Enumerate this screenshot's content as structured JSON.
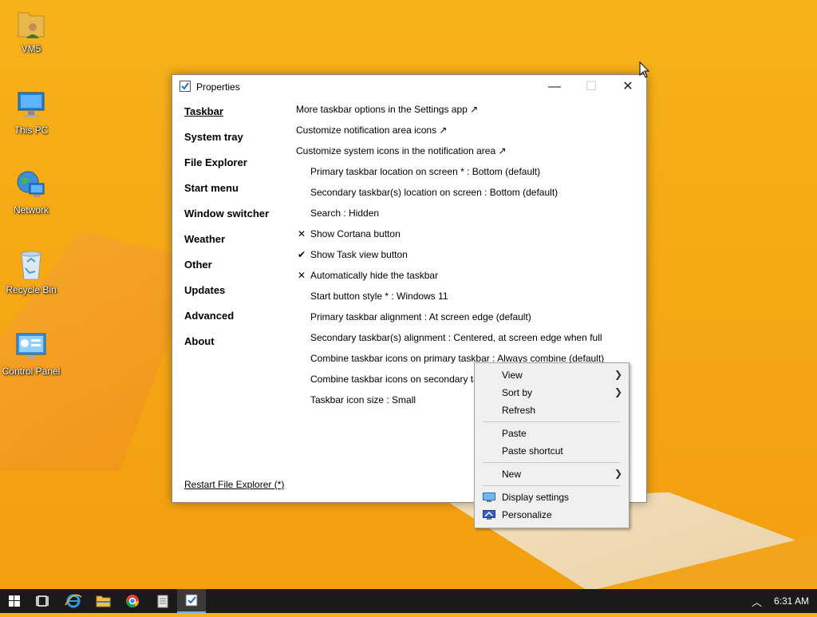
{
  "desktop": {
    "icons": [
      {
        "label": "VM5",
        "icon": "user-folder-icon"
      },
      {
        "label": "This PC",
        "icon": "computer-icon"
      },
      {
        "label": "Network",
        "icon": "network-globe-icon"
      },
      {
        "label": "Recycle Bin",
        "icon": "recycle-bin-icon"
      },
      {
        "label": "Control Panel",
        "icon": "control-panel-icon"
      }
    ]
  },
  "window": {
    "title": "Properties",
    "icon": "properties-check-icon",
    "controls": {
      "minimize": "—",
      "maximize": "☐",
      "close": "✕"
    },
    "sidebar": [
      {
        "label": "Taskbar",
        "active": true
      },
      {
        "label": "System tray"
      },
      {
        "label": "File Explorer"
      },
      {
        "label": "Start menu"
      },
      {
        "label": "Window switcher"
      },
      {
        "label": "Weather"
      },
      {
        "label": "Other"
      },
      {
        "label": "Updates"
      },
      {
        "label": "Advanced"
      },
      {
        "label": "About"
      }
    ],
    "restart_link": "Restart File Explorer (*)",
    "options": [
      {
        "type": "link",
        "text": "More taskbar options in the Settings app ↗"
      },
      {
        "type": "link",
        "text": "Customize notification area icons ↗"
      },
      {
        "type": "link",
        "text": "Customize system icons in the notification area ↗"
      },
      {
        "type": "setting",
        "mark": "",
        "text": "Primary taskbar location on screen * : Bottom (default)"
      },
      {
        "type": "setting",
        "mark": "",
        "text": "Secondary taskbar(s) location on screen : Bottom (default)"
      },
      {
        "type": "setting",
        "mark": "",
        "text": "Search : Hidden"
      },
      {
        "type": "setting",
        "mark": "✕",
        "text": "Show Cortana button"
      },
      {
        "type": "setting",
        "mark": "✔",
        "text": "Show Task view button"
      },
      {
        "type": "setting",
        "mark": "✕",
        "text": "Automatically hide the taskbar"
      },
      {
        "type": "setting",
        "mark": "",
        "text": "Start button style * : Windows 11"
      },
      {
        "type": "setting",
        "mark": "",
        "text": "Primary taskbar alignment : At screen edge (default)"
      },
      {
        "type": "setting",
        "mark": "",
        "text": "Secondary taskbar(s) alignment : Centered, at screen edge when full"
      },
      {
        "type": "setting",
        "mark": "",
        "text": "Combine taskbar icons on primary taskbar : Always combine (default)"
      },
      {
        "type": "setting",
        "mark": "",
        "text": "Combine taskbar icons on secondary ta"
      },
      {
        "type": "setting",
        "mark": "",
        "text": "Taskbar icon size : Small"
      }
    ]
  },
  "context_menu": {
    "view": "View",
    "sort_by": "Sort by",
    "refresh": "Refresh",
    "paste": "Paste",
    "paste_shortcut": "Paste shortcut",
    "new": "New",
    "display_settings": "Display settings",
    "personalize": "Personalize",
    "submenu_arrow": "❯"
  },
  "taskbar": {
    "buttons": [
      "start-icon",
      "task-view-icon",
      "internet-explorer-icon",
      "file-explorer-icon",
      "chrome-icon",
      "notepad-icon",
      "properties-check-icon"
    ],
    "tray_chevron": "︿",
    "clock": "6:31 AM"
  }
}
